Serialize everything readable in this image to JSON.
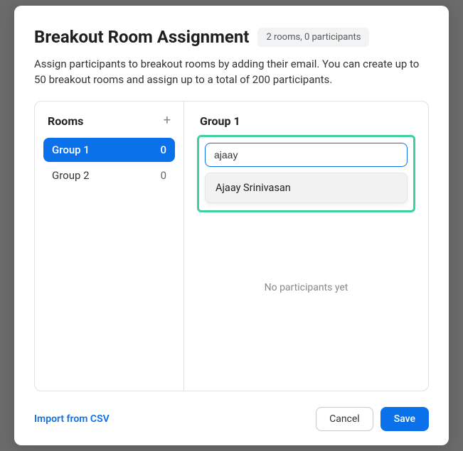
{
  "header": {
    "title": "Breakout Room Assignment",
    "summary": "2 rooms, 0 participants"
  },
  "description": "Assign participants to breakout rooms by adding their email. You can create up to 50 breakout rooms and assign up to a total of 200 participants.",
  "rooms": {
    "title": "Rooms",
    "add_icon": "+",
    "items": [
      {
        "name": "Group 1",
        "count": "0",
        "active": true
      },
      {
        "name": "Group 2",
        "count": "0",
        "active": false
      }
    ]
  },
  "detail": {
    "group_title": "Group 1",
    "search_value": "ajaay",
    "suggestions": [
      "Ajaay Srinivasan"
    ],
    "empty_text": "No participants yet"
  },
  "footer": {
    "import_label": "Import from CSV",
    "cancel_label": "Cancel",
    "save_label": "Save"
  }
}
